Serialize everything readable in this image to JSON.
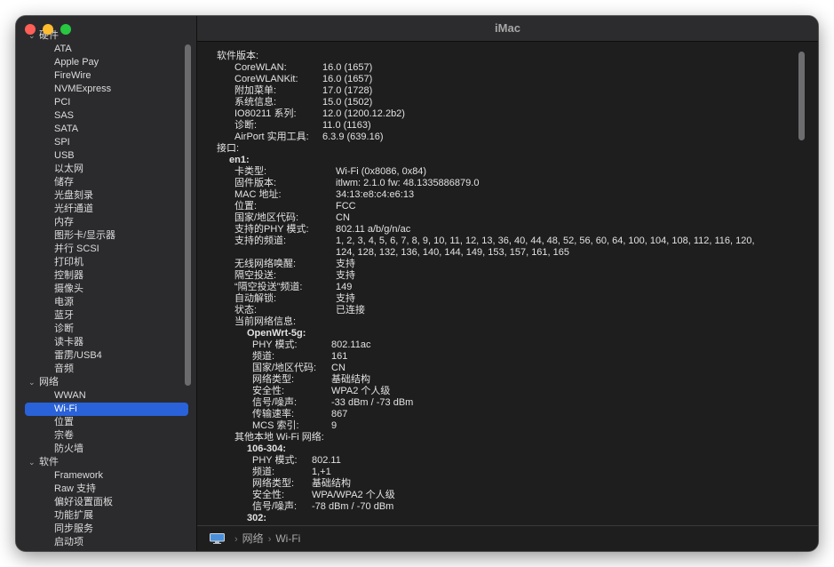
{
  "window": {
    "title": "iMac"
  },
  "sidebar": {
    "rows": [
      {
        "type": "group",
        "label": "硬件",
        "name": "sidebar-group-hardware"
      },
      {
        "type": "child",
        "label": "ATA",
        "name": "sidebar-item-ata"
      },
      {
        "type": "child",
        "label": "Apple Pay",
        "name": "sidebar-item-apple-pay"
      },
      {
        "type": "child",
        "label": "FireWire",
        "name": "sidebar-item-firewire"
      },
      {
        "type": "child",
        "label": "NVMExpress",
        "name": "sidebar-item-nvmexpress"
      },
      {
        "type": "child",
        "label": "PCI",
        "name": "sidebar-item-pci"
      },
      {
        "type": "child",
        "label": "SAS",
        "name": "sidebar-item-sas"
      },
      {
        "type": "child",
        "label": "SATA",
        "name": "sidebar-item-sata"
      },
      {
        "type": "child",
        "label": "SPI",
        "name": "sidebar-item-spi"
      },
      {
        "type": "child",
        "label": "USB",
        "name": "sidebar-item-usb"
      },
      {
        "type": "child",
        "label": "以太网",
        "name": "sidebar-item-ethernet"
      },
      {
        "type": "child",
        "label": "储存",
        "name": "sidebar-item-storage"
      },
      {
        "type": "child",
        "label": "光盘刻录",
        "name": "sidebar-item-disc-burning"
      },
      {
        "type": "child",
        "label": "光纤通道",
        "name": "sidebar-item-fibre-channel"
      },
      {
        "type": "child",
        "label": "内存",
        "name": "sidebar-item-memory"
      },
      {
        "type": "child",
        "label": "图形卡/显示器",
        "name": "sidebar-item-graphics-displays"
      },
      {
        "type": "child",
        "label": "并行 SCSI",
        "name": "sidebar-item-parallel-scsi"
      },
      {
        "type": "child",
        "label": "打印机",
        "name": "sidebar-item-printers"
      },
      {
        "type": "child",
        "label": "控制器",
        "name": "sidebar-item-controller"
      },
      {
        "type": "child",
        "label": "摄像头",
        "name": "sidebar-item-camera"
      },
      {
        "type": "child",
        "label": "电源",
        "name": "sidebar-item-power"
      },
      {
        "type": "child",
        "label": "蓝牙",
        "name": "sidebar-item-bluetooth"
      },
      {
        "type": "child",
        "label": "诊断",
        "name": "sidebar-item-diagnostics"
      },
      {
        "type": "child",
        "label": "读卡器",
        "name": "sidebar-item-card-reader"
      },
      {
        "type": "child",
        "label": "雷雳/USB4",
        "name": "sidebar-item-thunderbolt-usb4"
      },
      {
        "type": "child",
        "label": "音频",
        "name": "sidebar-item-audio"
      },
      {
        "type": "group",
        "label": "网络",
        "name": "sidebar-group-network"
      },
      {
        "type": "child",
        "label": "WWAN",
        "name": "sidebar-item-wwan"
      },
      {
        "type": "child",
        "label": "Wi-Fi",
        "name": "sidebar-item-wifi",
        "selected": true
      },
      {
        "type": "child",
        "label": "位置",
        "name": "sidebar-item-locations"
      },
      {
        "type": "child",
        "label": "宗卷",
        "name": "sidebar-item-volumes"
      },
      {
        "type": "child",
        "label": "防火墙",
        "name": "sidebar-item-firewall"
      },
      {
        "type": "group",
        "label": "软件",
        "name": "sidebar-group-software"
      },
      {
        "type": "child",
        "label": "Framework",
        "name": "sidebar-item-framework"
      },
      {
        "type": "child",
        "label": "Raw 支持",
        "name": "sidebar-item-raw-support"
      },
      {
        "type": "child",
        "label": "偏好设置面板",
        "name": "sidebar-item-preference-panes"
      },
      {
        "type": "child",
        "label": "功能扩展",
        "name": "sidebar-item-extensions"
      },
      {
        "type": "child",
        "label": "同步服务",
        "name": "sidebar-item-sync-services"
      },
      {
        "type": "child",
        "label": "启动项",
        "name": "sidebar-item-startup-items"
      }
    ]
  },
  "detail": {
    "lines": [
      {
        "key": "软件版本:",
        "value": "",
        "k": 22,
        "bold": false
      },
      {
        "key": "CoreWLAN:",
        "value": "16.0 (1657)",
        "k": 42,
        "v": 141
      },
      {
        "key": "CoreWLANKit:",
        "value": "16.0 (1657)",
        "k": 42,
        "v": 141
      },
      {
        "key": "附加菜单:",
        "value": "17.0 (1728)",
        "k": 42,
        "v": 141
      },
      {
        "key": "系统信息:",
        "value": "15.0 (1502)",
        "k": 42,
        "v": 141
      },
      {
        "key": "IO80211 系列:",
        "value": "12.0 (1200.12.2b2)",
        "k": 42,
        "v": 141
      },
      {
        "key": "诊断:",
        "value": "11.0 (1163)",
        "k": 42,
        "v": 141
      },
      {
        "key": "AirPort 实用工具:",
        "value": "6.3.9 (639.16)",
        "k": 42,
        "v": 141
      },
      {
        "key": "接口:",
        "value": "",
        "k": 22
      },
      {
        "key": "en1:",
        "value": "",
        "k": 36,
        "bold": true
      },
      {
        "key": "卡类型:",
        "value": "Wi-Fi  (0x8086, 0x84)",
        "k": 42,
        "v": 156
      },
      {
        "key": "固件版本:",
        "value": "itlwm: 2.1.0 fw: 48.1335886879.0",
        "k": 42,
        "v": 156
      },
      {
        "key": "MAC 地址:",
        "value": "34:13:e8:c4:e6:13",
        "k": 42,
        "v": 156
      },
      {
        "key": "位置:",
        "value": "FCC",
        "k": 42,
        "v": 156
      },
      {
        "key": "国家/地区代码:",
        "value": "CN",
        "k": 42,
        "v": 156
      },
      {
        "key": "支持的PHY 模式:",
        "value": "802.11 a/b/g/n/ac",
        "k": 42,
        "v": 156
      },
      {
        "key": "支持的频道:",
        "value": "1, 2, 3, 4, 5, 6, 7, 8, 9, 10, 11, 12, 13, 36, 40, 44, 48, 52, 56, 60, 64, 100, 104, 108, 112, 116, 120,",
        "k": 42,
        "v": 156
      },
      {
        "key": "",
        "value": "124, 128, 132, 136, 140, 144, 149, 153, 157, 161, 165",
        "k": 42,
        "v": 156
      },
      {
        "key": "无线网络唤醒:",
        "value": "支持",
        "k": 42,
        "v": 156
      },
      {
        "key": "隔空投送:",
        "value": "支持",
        "k": 42,
        "v": 156
      },
      {
        "key": "“隔空投送”频道:",
        "value": "149",
        "k": 42,
        "v": 156
      },
      {
        "key": "自动解锁:",
        "value": "支持",
        "k": 42,
        "v": 156
      },
      {
        "key": "状态:",
        "value": "已连接",
        "k": 42,
        "v": 156
      },
      {
        "key": "当前网络信息:",
        "value": "",
        "k": 42
      },
      {
        "key": "OpenWrt-5g:",
        "value": "",
        "k": 56,
        "bold": true
      },
      {
        "key": "PHY 模式:",
        "value": "802.11ac",
        "k": 62,
        "v": 151
      },
      {
        "key": "频道:",
        "value": "161",
        "k": 62,
        "v": 151
      },
      {
        "key": "国家/地区代码:",
        "value": "CN",
        "k": 62,
        "v": 151
      },
      {
        "key": "网络类型:",
        "value": "基础结构",
        "k": 62,
        "v": 151
      },
      {
        "key": "安全性:",
        "value": "WPA2 个人级",
        "k": 62,
        "v": 151
      },
      {
        "key": "信号/噪声:",
        "value": "-33 dBm / -73 dBm",
        "k": 62,
        "v": 151
      },
      {
        "key": "传输速率:",
        "value": "867",
        "k": 62,
        "v": 151
      },
      {
        "key": "MCS 索引:",
        "value": "9",
        "k": 62,
        "v": 151
      },
      {
        "key": "其他本地 Wi-Fi 网络:",
        "value": "",
        "k": 42
      },
      {
        "key": "106-304:",
        "value": "",
        "k": 56,
        "bold": true
      },
      {
        "key": "PHY 模式:",
        "value": "802.11",
        "k": 62,
        "v": 129
      },
      {
        "key": "频道:",
        "value": "1,+1",
        "k": 62,
        "v": 129
      },
      {
        "key": "网络类型:",
        "value": "基础结构",
        "k": 62,
        "v": 129
      },
      {
        "key": "安全性:",
        "value": "WPA/WPA2 个人级",
        "k": 62,
        "v": 129
      },
      {
        "key": "信号/噪声:",
        "value": "-78 dBm / -70 dBm",
        "k": 62,
        "v": 129
      },
      {
        "key": "302:",
        "value": "",
        "k": 56,
        "bold": true
      }
    ]
  },
  "statusbar": {
    "breadcrumbs": [
      "网络",
      "Wi-Fi"
    ],
    "icon": "imac-icon"
  }
}
